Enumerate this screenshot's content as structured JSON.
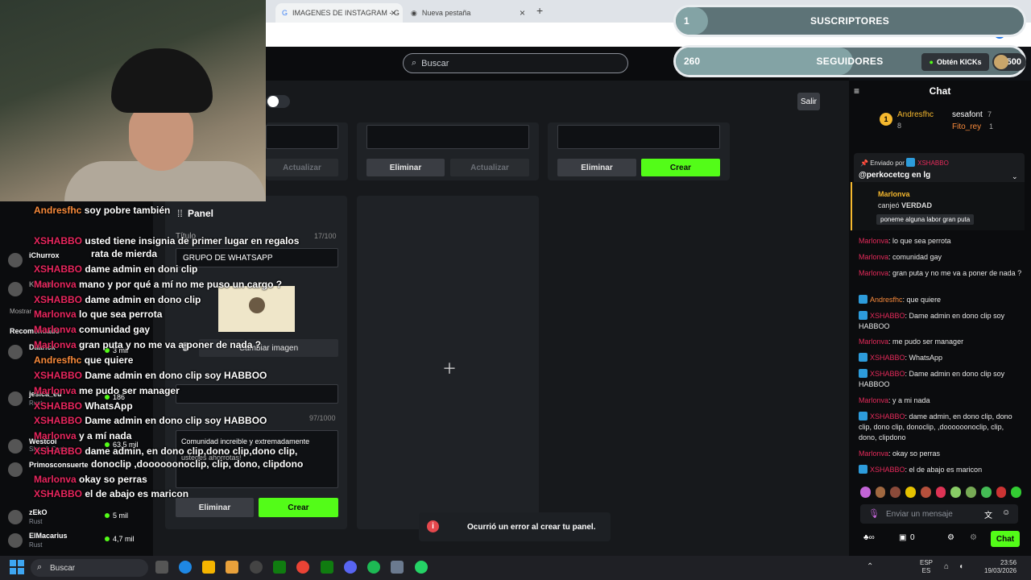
{
  "browser": {
    "tabs": [
      {
        "title": "IMAGENES DE INSTAGRAM - G"
      },
      {
        "title": "Nueva pestaña"
      }
    ]
  },
  "site": {
    "search_placeholder": "Buscar",
    "exit_label": "Salir"
  },
  "overlay": {
    "subs_count": "1",
    "subs_label": "SUSCRIPTORES",
    "followers_count": "260",
    "followers_label": "SEGUIDORES",
    "kicks_label": "Obtén KICKs",
    "coins": "500"
  },
  "panels_top": [
    {
      "left_label": "Actualizar",
      "left_disabled": true
    },
    {
      "left_label": "Eliminar",
      "right_label": "Actualizar"
    },
    {
      "left_label": "Eliminar",
      "right_label": "Crear"
    }
  ],
  "panel_form": {
    "title": "Panel",
    "title_label": "Título",
    "title_count": "17/100",
    "title_value": "GRUPO DE WHATSAPP",
    "change_image": "Cambiar imagen",
    "desc_count": "97/1000",
    "desc_value": "Comunidad increible y extremadamente",
    "desc_value2": "ustedes ahorrotas!",
    "delete_label": "Eliminar",
    "create_label": "Crear"
  },
  "toast": {
    "message": "Ocurrió un error al crear tu panel."
  },
  "chat": {
    "header": "Chat",
    "top_users": [
      {
        "name": "Andresfhc",
        "count": "8"
      },
      {
        "name": "sesafont",
        "count": "7"
      },
      {
        "name": "Fito_rey",
        "count": "1"
      }
    ],
    "pinned_by": "Enviado por",
    "pinned_user": "XSHABBO",
    "pinned_text": "@perkocetcg en lg",
    "redeem_user": "Marlonva",
    "redeem_action": "canjeó",
    "redeem_reward": "VERDAD",
    "redeem_text": "poneme alguna labor gran puta",
    "messages": [
      {
        "user": "Marlonva",
        "text": ": lo que sea perrota"
      },
      {
        "user": "Marlonva",
        "text": ": comunidad gay"
      },
      {
        "user": "Marlonva",
        "text": ": gran puta y no me va a poner de nada ?"
      },
      {
        "user": "Andresfhc",
        "text": ": que quiere"
      },
      {
        "user": "XSHABBO",
        "text": ": Dame admin en dono clip soy HABBOO"
      },
      {
        "user": "Marlonva",
        "text": ": me pudo ser manager"
      },
      {
        "user": "XSHABBO",
        "text": ": WhatsApp"
      },
      {
        "user": "XSHABBO",
        "text": ": Dame admin en dono clip soy HABBOO"
      },
      {
        "user": "Marlonva",
        "text": ": y a mi nada"
      },
      {
        "user": "XSHABBO",
        "text": ": dame admin, en dono clip, dono clip, dono clip, donoclip, ,doooooonoclip, clip, dono, clipdono"
      },
      {
        "user": "Marlonva",
        "text": ": okay so perras"
      },
      {
        "user": "XSHABBO",
        "text": ": el de abajo es maricon"
      }
    ],
    "input_placeholder": "Enviar un mensaje",
    "send_label": "Chat",
    "footer_count": "0"
  },
  "sidebar": {
    "show_more": "Mostrar",
    "recommended": "Recomendado",
    "items": [
      {
        "name": "iChurrox",
        "sub": "",
        "viewers": ""
      },
      {
        "name": "Kacula",
        "sub": "",
        "viewers": ""
      },
      {
        "name": "Daarick",
        "sub": "",
        "viewers": "3 mil"
      },
      {
        "name": "jesica_eu",
        "sub": "Rust",
        "viewers": "186"
      },
      {
        "name": "Westcol",
        "sub": "Slots & Casino",
        "viewers": "63,5 mil"
      },
      {
        "name": "Primosconsuerte",
        "sub": "",
        "viewers": ""
      },
      {
        "name": "zEkO",
        "sub": "Rust",
        "viewers": "5 mil"
      },
      {
        "name": "ElMacarius",
        "sub": "Rust",
        "viewers": "4,7 mil"
      }
    ]
  },
  "overlay_chat": [
    {
      "user": "Andresfhc",
      "text": "soy pobre también"
    },
    {
      "user": "XSHABBO",
      "text": "usted tiene insignia de primer lugar en regalos"
    },
    {
      "user": "",
      "text": "rata de mierda"
    },
    {
      "user": "XSHABBO",
      "text": "dame admin en doni clip"
    },
    {
      "user": "Marlonva",
      "text": "mano y por qué a mí no me puso un cargo ?"
    },
    {
      "user": "XSHABBO",
      "text": "dame admin en dono clip"
    },
    {
      "user": "Marlonva",
      "text": "lo que sea perrota"
    },
    {
      "user": "Marlonva",
      "text": "comunidad gay"
    },
    {
      "user": "Marlonva",
      "text": "gran puta y no me va a poner de nada ?"
    },
    {
      "user": "Andresfhc",
      "text": "que quiere"
    },
    {
      "user": "XSHABBO",
      "text": "Dame admin en dono clip soy HABBOO"
    },
    {
      "user": "Marlonva",
      "text": "me pudo ser manager"
    },
    {
      "user": "XSHABBO",
      "text": "WhatsApp"
    },
    {
      "user": "XSHABBO",
      "text": "Dame admin en dono clip soy HABBOO"
    },
    {
      "user": "Marlonva",
      "text": "y a mí nada"
    },
    {
      "user": "XSHABBO",
      "text": "dame admin, en dono clip,dono clip,dono clip,"
    },
    {
      "user": "",
      "text": "donoclip ,doooooonoclip, clip, dono, clipdono"
    },
    {
      "user": "Marlonva",
      "text": "okay so perras"
    },
    {
      "user": "XSHABBO",
      "text": "el de abajo es maricon"
    }
  ],
  "taskbar": {
    "search": "Buscar",
    "lang1": "ESP",
    "lang2": "ES",
    "time": "23:56",
    "date": "19/03/2026"
  }
}
